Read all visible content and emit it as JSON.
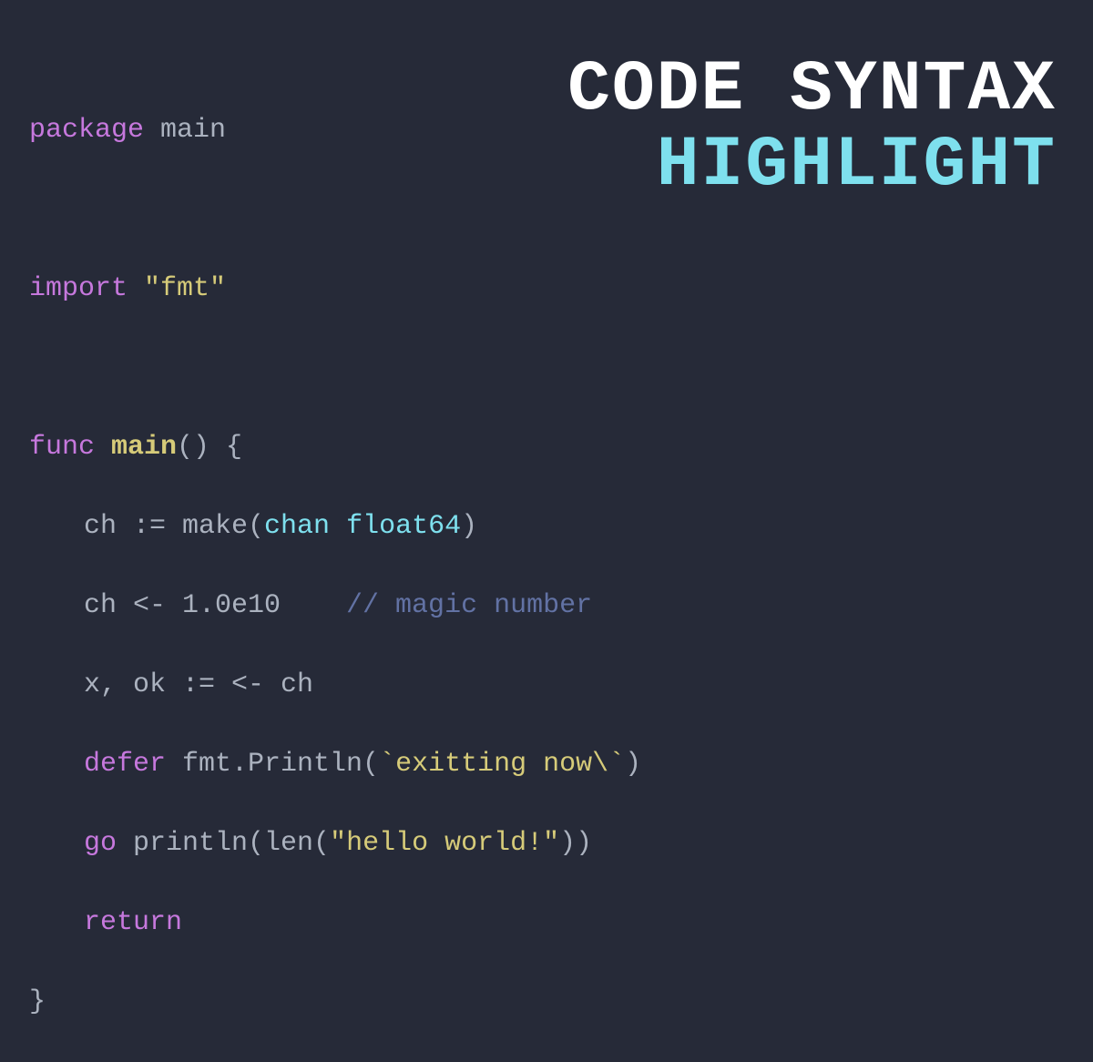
{
  "title": {
    "line1": "CODE SYNTAX",
    "line2": "HIGHLIGHT"
  },
  "code": {
    "l1": {
      "kw": "package",
      "sp": " ",
      "id": "main"
    },
    "l2": {
      "kw": "import",
      "sp": " ",
      "str": "\"fmt\""
    },
    "l3": {
      "kw": "func",
      "sp": " ",
      "fn": "main",
      "rest": "() {"
    },
    "l4": {
      "a": "ch := make(",
      "chan": "chan",
      "sp": " ",
      "type": "float64",
      "b": ")"
    },
    "l5": {
      "a": "ch <- 1.0e10    ",
      "cmt": "// magic number"
    },
    "l6": {
      "a": "x, ok := <- ch"
    },
    "l7": {
      "kw": "defer",
      "rest": " fmt.Println(",
      "str": "`exitting now\\`",
      "close": ")"
    },
    "l8": {
      "kw": "go",
      "rest": " println(len(",
      "str": "\"hello world!\"",
      "close": "))"
    },
    "l9": {
      "kw": "return"
    },
    "l10": {
      "a": "}"
    }
  }
}
